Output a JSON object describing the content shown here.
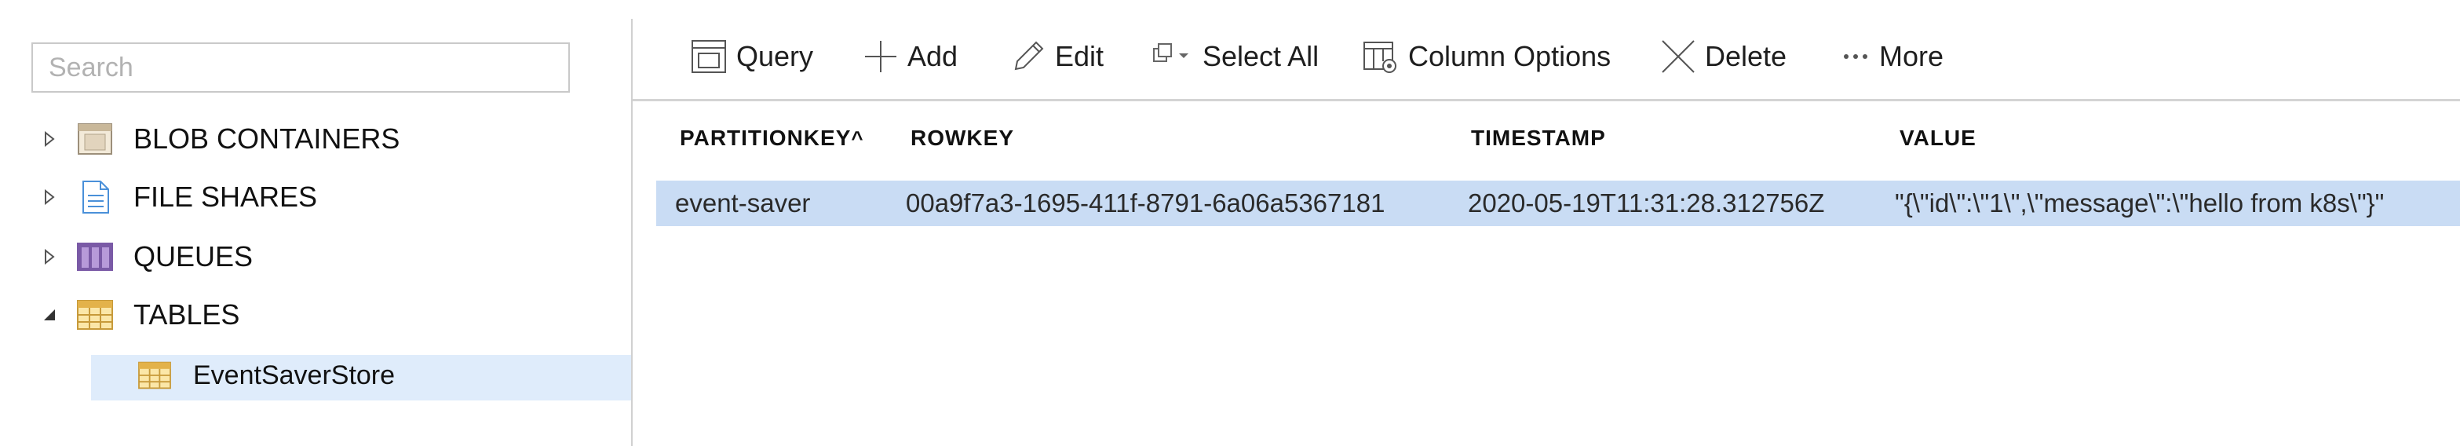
{
  "sidebar": {
    "search_placeholder": "Search",
    "items": [
      {
        "label": "BLOB CONTAINERS",
        "icon": "blob-container-icon",
        "expanded": false
      },
      {
        "label": "FILE SHARES",
        "icon": "file-share-icon",
        "expanded": false
      },
      {
        "label": "QUEUES",
        "icon": "queue-icon",
        "expanded": false
      },
      {
        "label": "TABLES",
        "icon": "table-icon",
        "expanded": true
      }
    ],
    "selected_child": {
      "label": "EventSaverStore",
      "icon": "table-icon"
    }
  },
  "toolbar": {
    "query": "Query",
    "add": "Add",
    "edit": "Edit",
    "select_all": "Select All",
    "column_options": "Column Options",
    "delete": "Delete",
    "more": "More"
  },
  "grid": {
    "columns": [
      "PARTITIONKEY",
      "ROWKEY",
      "TIMESTAMP",
      "VALUE"
    ],
    "sort_indicator": "^",
    "rows": [
      {
        "partitionkey": "event-saver",
        "rowkey": "00a9f7a3-1695-411f-8791-6a06a5367181",
        "timestamp": "2020-05-19T11:31:28.312756Z",
        "value": "\"{\\\"id\\\":\\\"1\\\",\\\"message\\\":\\\"hello from k8s\\\"}\""
      }
    ]
  },
  "colors": {
    "selected_tree_bg": "#dfecfb",
    "selected_row_bg": "#c9dcf4",
    "divider": "#d0d0d0"
  }
}
